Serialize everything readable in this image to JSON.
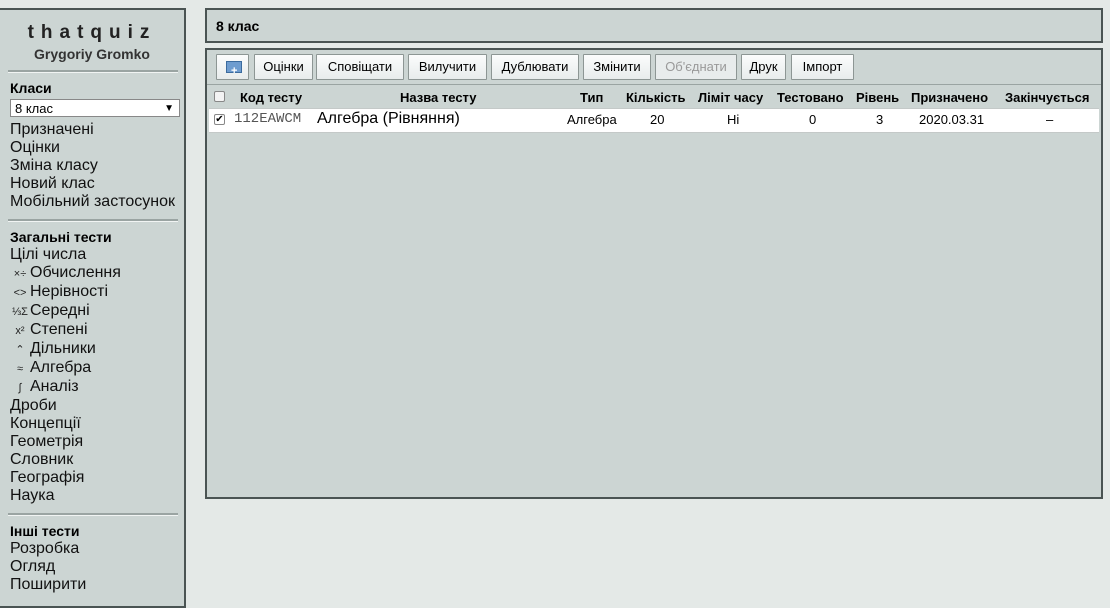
{
  "brand": {
    "title": "thatquiz",
    "user": "Grygoriy Gromko"
  },
  "sidebar": {
    "classes_heading": "Класи",
    "class_select": "8 клас",
    "class_items": [
      "Призначені",
      "Оцінки",
      "Зміна класу",
      "Новий клас",
      "Мобільний застосунок"
    ],
    "general_heading": "Загальні тести",
    "general_items": [
      {
        "label": "Цілі числа",
        "icon": ""
      },
      {
        "label": "Обчислення",
        "icon": "×÷"
      },
      {
        "label": "Нерівності",
        "icon": "<>"
      },
      {
        "label": "Середні",
        "icon": "⅓Σ"
      },
      {
        "label": "Степені",
        "icon": "x²"
      },
      {
        "label": "Дільники",
        "icon": "⌃"
      },
      {
        "label": "Алгебра",
        "icon": "≈"
      },
      {
        "label": "Аналіз",
        "icon": "∫"
      },
      {
        "label": "Дроби",
        "icon": ""
      },
      {
        "label": "Концепції",
        "icon": ""
      },
      {
        "label": "Геометрія",
        "icon": ""
      },
      {
        "label": "Словник",
        "icon": ""
      },
      {
        "label": "Географія",
        "icon": ""
      },
      {
        "label": "Наука",
        "icon": ""
      }
    ],
    "other_heading": "Інші тести",
    "other_items": [
      "Розробка",
      "Огляд",
      "Поширити"
    ]
  },
  "header": {
    "title": "8 клас"
  },
  "toolbar": {
    "grades": "Оцінки",
    "notify": "Сповіщати",
    "remove": "Вилучити",
    "duplicate": "Дублювати",
    "change": "Змінити",
    "merge": "Об'єднати",
    "print": "Друк",
    "import": "Імпорт"
  },
  "table": {
    "headers": {
      "code": "Код тесту",
      "name": "Назва тесту",
      "type": "Тип",
      "count": "Кількість",
      "time_limit": "Ліміт часу",
      "tested": "Тестовано",
      "level": "Рівень",
      "assigned": "Призначено",
      "ends": "Закінчується"
    },
    "rows": [
      {
        "code": "112EAWCM",
        "name": "Алгебра (Рівняння)",
        "type": "Алгебра",
        "count": "20",
        "time_limit": "Ні",
        "tested": "0",
        "level": "3",
        "assigned": "2020.03.31",
        "ends": "–"
      }
    ]
  }
}
